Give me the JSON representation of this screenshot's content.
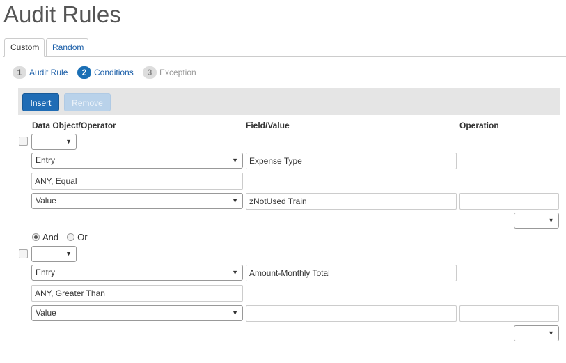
{
  "page": {
    "title": "Audit Rules"
  },
  "tabs": [
    {
      "label": "Custom",
      "active": true
    },
    {
      "label": "Random",
      "active": false
    }
  ],
  "steps": [
    {
      "num": "1",
      "label": "Audit Rule",
      "state": "done"
    },
    {
      "num": "2",
      "label": "Conditions",
      "state": "current"
    },
    {
      "num": "3",
      "label": "Exception",
      "state": "disabled"
    }
  ],
  "toolbar": {
    "insert_label": "Insert",
    "remove_label": "Remove"
  },
  "columns": {
    "data_object": "Data Object/Operator",
    "field_value": "Field/Value",
    "operation": "Operation"
  },
  "conditions": [
    {
      "paren": "",
      "entry_select": "Entry",
      "field_text": "Expense Type",
      "operator_text": "ANY, Equal",
      "value_select": "Value",
      "value_text": "zNotUsed Train",
      "operation_text": "",
      "close_paren": ""
    },
    {
      "paren": "",
      "entry_select": "Entry",
      "field_text": "Amount-Monthly Total",
      "operator_text": "ANY, Greater Than",
      "value_select": "Value",
      "value_text": "",
      "operation_text": "",
      "close_paren": ""
    }
  ],
  "logic": {
    "and_label": "And",
    "or_label": "Or",
    "selected": "And"
  },
  "icons": {
    "dropdown": "caret-down-icon"
  }
}
